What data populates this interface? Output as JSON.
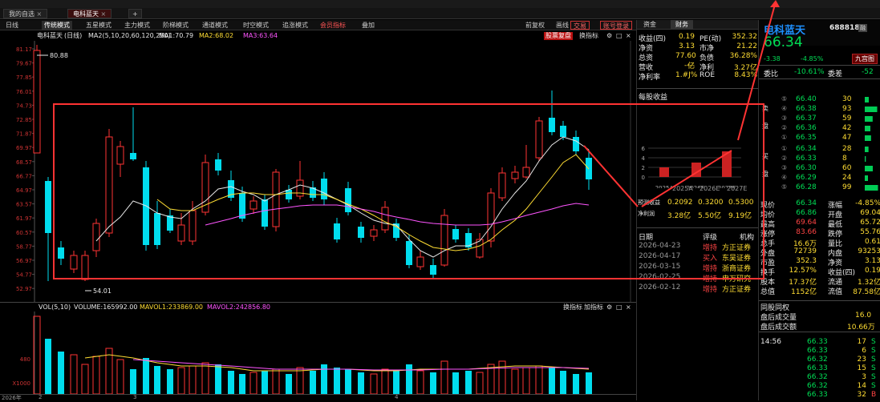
{
  "tabs": [
    "我的自选",
    "电科蓝天"
  ],
  "toolbar": [
    "日线",
    "传统模式",
    "五星模式",
    "主力模式",
    "阶梯模式",
    "通道模式",
    "时空模式",
    "追涨模式",
    "会员指标",
    "叠加"
  ],
  "toolbar_right": [
    "前复权",
    "画线",
    "交易",
    "账号登录"
  ],
  "chart_info": {
    "name": "电科蓝天",
    "period": "(日线)",
    "ma": "MA2(5,10,20,60,120,250)",
    "ma1": "MA1:70.79",
    "ma2": "MA2:68.02",
    "ma3": "MA3:63.64",
    "btn_fupan": "股票复盘",
    "btn_switch": "换指标"
  },
  "y_ticks": [
    "81.17",
    "79.67",
    "77.85",
    "76.01",
    "74.73",
    "72.85",
    "71.87",
    "69.97",
    "68.57",
    "66.77",
    "64.97",
    "63.57",
    "61.97",
    "60.57",
    "58.77",
    "56.97",
    "54.77",
    "52.97"
  ],
  "hi_label": "80.88",
  "lo_label": "54.01",
  "x_ticks": [
    "2026年",
    "2",
    "3",
    "4"
  ],
  "vol": {
    "title": "VOL(5,10)",
    "volume": "VOLUME:165992.00",
    "mavol1": "MAVOL1:233869.00",
    "mavol2": "MAVOL2:242856.80",
    "btn_switch": "换指标",
    "btn_add": "加指标",
    "y_ticks": [
      "480",
      "X1000"
    ]
  },
  "fin": {
    "tabs": [
      "资金",
      "财务"
    ],
    "rows": [
      [
        "收益(四)",
        "0.19",
        "PE(动)",
        "352.32"
      ],
      [
        "净资",
        "3.13",
        "市净",
        "21.22"
      ],
      [
        "总资",
        "77.60亿",
        "负债",
        "36.28%"
      ],
      [
        "营收",
        "----",
        "净利",
        "3.27亿"
      ],
      [
        "净利率",
        "1.#J%",
        "ROE",
        "8.43%"
      ]
    ],
    "eps_title": "每股收益",
    "eps_years": [
      "2025A",
      "2026E",
      "2027E"
    ],
    "eps_rows": [
      [
        "预测收益",
        "0.2092",
        "0.3200",
        "0.5300"
      ],
      [
        "净利润",
        "3.28亿",
        "5.50亿",
        "9.19亿"
      ]
    ],
    "rating_hdr": [
      "日期",
      "评级",
      "机构"
    ],
    "ratings": [
      [
        "2026-04-23",
        "增持",
        "方正证券"
      ],
      [
        "2026-04-17",
        "买入",
        "东吴证券"
      ],
      [
        "2026-03-15",
        "增持",
        "浙商证券"
      ],
      [
        "2026-02-25",
        "增持",
        "申万研究"
      ],
      [
        "2026-02-12",
        "增持",
        "方正证券"
      ]
    ]
  },
  "quote": {
    "name": "电科蓝天",
    "code": "688818",
    "price": "66.34",
    "chg": "-3.38",
    "pct": "-4.85%",
    "btn": "九宫图",
    "weibi": "委比",
    "weibi_v": "-10.61%",
    "weicha": "委差",
    "weicha_v": "-52",
    "sell": [
      [
        "66.40",
        "30"
      ],
      [
        "66.38",
        "93"
      ],
      [
        "66.37",
        "59"
      ],
      [
        "66.36",
        "42"
      ],
      [
        "66.35",
        "47"
      ]
    ],
    "buy": [
      [
        "66.34",
        "28"
      ],
      [
        "66.33",
        "8"
      ],
      [
        "66.30",
        "60"
      ],
      [
        "66.29",
        "24"
      ],
      [
        "66.28",
        "99"
      ]
    ],
    "stats": [
      [
        "现价",
        "66.34",
        "涨幅",
        "-4.85%"
      ],
      [
        "均价",
        "66.86",
        "开盘",
        "69.04"
      ],
      [
        "最高",
        "69.64",
        "最低",
        "65.72"
      ],
      [
        "涨停",
        "83.66",
        "跌停",
        "55.76"
      ],
      [
        "总手",
        "16.6万",
        "量比",
        "0.61"
      ],
      [
        "外盘",
        "72739",
        "内盘",
        "93253"
      ],
      [
        "市盈",
        "352.3",
        "净资",
        "3.13"
      ],
      [
        "换手",
        "12.57%",
        "收益(四)",
        "0.19"
      ],
      [
        "股本",
        "17.37亿",
        "流通",
        "1.32亿"
      ],
      [
        "总值",
        "1152亿",
        "流值",
        "87.58亿"
      ]
    ],
    "tongji": "同股同权",
    "after_vol": "盘后成交量",
    "after_vol_v": "16.0",
    "after_amt": "盘后成交额",
    "after_amt_v": "10.66万",
    "time": "14:56",
    "ticks": [
      [
        "66.33",
        "17",
        "S"
      ],
      [
        "66.33",
        "6",
        "S"
      ],
      [
        "66.32",
        "23",
        "S"
      ],
      [
        "66.33",
        "15",
        "S"
      ],
      [
        "66.32",
        "3",
        "S"
      ],
      [
        "66.32",
        "14",
        "S"
      ],
      [
        "66.33",
        "32",
        "B"
      ]
    ]
  }
}
